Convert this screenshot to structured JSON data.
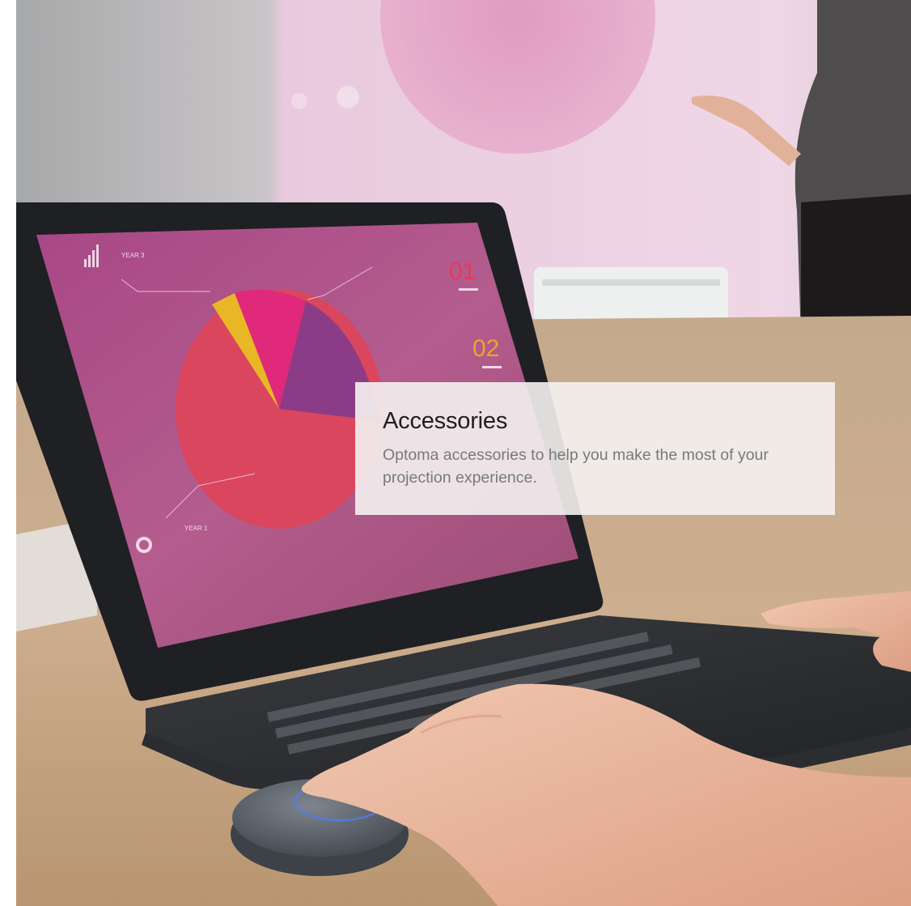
{
  "hero": {
    "title": "Accessories",
    "description": "Optoma accessories to help you make the most of your projection experience."
  },
  "photo": {
    "subject": "laptop-with-pie-chart-and-wireless-presentation-button"
  },
  "screen": {
    "year_left": "YEAR 1",
    "year_top": "YEAR 3",
    "big_num_1": "01",
    "big_num_2": "02"
  },
  "colors": {
    "overlay_bg": "#f4f2f1",
    "title": "#1e1e1e",
    "desc": "#777a7c",
    "screen_magenta": "#9b3a77",
    "accent_orange": "#f0a22b"
  }
}
